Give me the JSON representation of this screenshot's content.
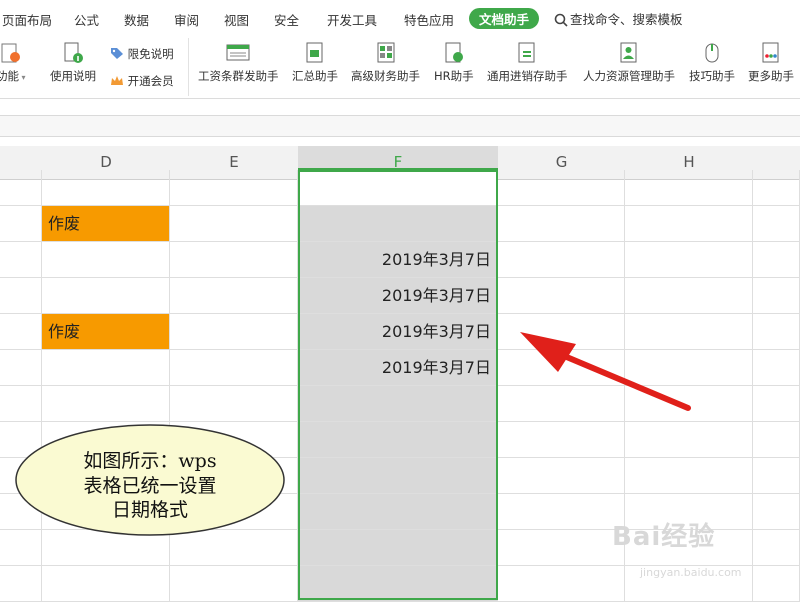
{
  "tabs": [
    "页面布局",
    "公式",
    "数据",
    "审阅",
    "视图",
    "安全",
    "开发工具",
    "特色应用",
    "文档助手"
  ],
  "active_tab": "文档助手",
  "search": {
    "label": "查找命令、搜索模板"
  },
  "ribbon": {
    "left_partial": "功能",
    "usage": "使用说明",
    "free_label": "限免说明",
    "vip_label": "开通会员",
    "buttons": [
      "工资条群发助手",
      "汇总助手",
      "高级财务助手",
      "HR助手",
      "通用进销存助手",
      "人力资源管理助手",
      "技巧助手",
      "更多助手"
    ]
  },
  "columns": [
    "D",
    "E",
    "F",
    "G",
    "H"
  ],
  "selected_column": "F",
  "rows": [
    {
      "d": "",
      "f": ""
    },
    {
      "d": "作废",
      "f": ""
    },
    {
      "d": "",
      "f": "2019年3月7日"
    },
    {
      "d": "",
      "f": "2019年3月7日"
    },
    {
      "d": "作废",
      "f": "2019年3月7日"
    },
    {
      "d": "",
      "f": "2019年3月7日"
    },
    {
      "d": "",
      "f": ""
    },
    {
      "d": "",
      "f": ""
    },
    {
      "d": "",
      "f": ""
    },
    {
      "d": "",
      "f": ""
    },
    {
      "d": "",
      "f": ""
    },
    {
      "d": "",
      "f": ""
    }
  ],
  "callout": {
    "line1": "如图所示：wps",
    "line2": "表格已统一设置",
    "line3": "日期格式"
  },
  "watermark": {
    "text": "Bai经验",
    "sub": "jingyan.baidu.com"
  },
  "colors": {
    "accent": "#3fa84a",
    "void_fill": "#f79a00",
    "arrow": "#e0201a",
    "callout_fill": "#fafad2"
  }
}
